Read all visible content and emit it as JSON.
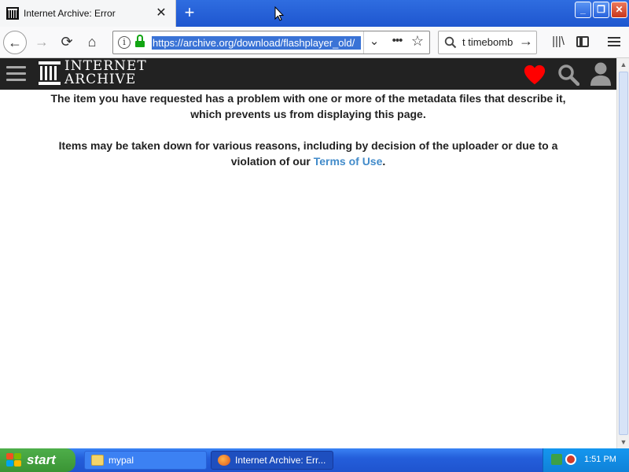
{
  "browser": {
    "tab_title": "Internet Archive: Error",
    "tab_close": "✕",
    "new_tab": "+",
    "window_buttons": {
      "minimize": "_",
      "restore": "❐",
      "close": "✕"
    },
    "nav": {
      "back": "←",
      "forward": "→",
      "reload": "⟳",
      "home": "⌂"
    },
    "url": "https://archive.org/download/flashplayer_old/",
    "url_info": "i",
    "url_dropdown": "⌄",
    "url_more": "•••",
    "bookmark": "☆",
    "search_text": "t timebomb",
    "search_go": "→",
    "library": "|||\\"
  },
  "site": {
    "logo_line1": "INTERNET",
    "logo_line2": "ARCHIVE",
    "icons": [
      "hamburger-icon",
      "ia-logo-icon",
      "heart-icon",
      "search-icon",
      "user-icon"
    ],
    "colors": {
      "header_bg": "#222222",
      "heart": "#ff0000",
      "link": "#428bca"
    }
  },
  "content": {
    "message1": "The item you have requested has a problem with one or more of the metadata files that describe it, which prevents us from displaying this page.",
    "message2_before": "Items may be taken down for various reasons, including by decision of the uploader or due to a violation of our ",
    "message2_link": "Terms of Use",
    "message2_after": "."
  },
  "taskbar": {
    "start_label": "start",
    "tasks": [
      {
        "label": "mypal",
        "icon": "folder-icon"
      },
      {
        "label": "Internet Archive: Err...",
        "icon": "firefox-icon"
      }
    ],
    "clock": "1:51 PM"
  }
}
